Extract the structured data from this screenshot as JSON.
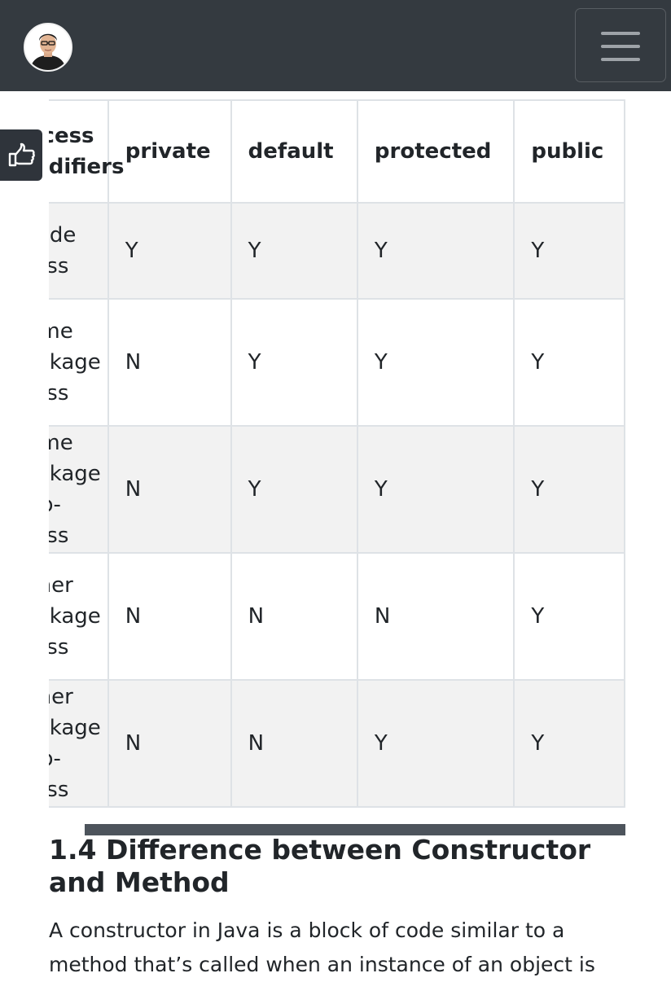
{
  "header": {
    "avatar_alt": "author avatar",
    "menu_icon": "hamburger-menu-icon",
    "background_color": "#343a40"
  },
  "side_tab": {
    "icon": "thumbs-up-hand-icon"
  },
  "access_table": {
    "headers": [
      "Access Modifiers",
      "private",
      "default",
      "protected",
      "public"
    ],
    "rows": [
      {
        "label": "Inside Class",
        "values": [
          "Y",
          "Y",
          "Y",
          "Y"
        ]
      },
      {
        "label": "Same Package Class",
        "values": [
          "N",
          "Y",
          "Y",
          "Y"
        ]
      },
      {
        "label": "Same Package Sub-Class",
        "values": [
          "N",
          "Y",
          "Y",
          "Y"
        ]
      },
      {
        "label": "Other Package Class",
        "values": [
          "N",
          "N",
          "N",
          "Y"
        ]
      },
      {
        "label": "Other Package Sub-Class",
        "values": [
          "N",
          "N",
          "Y",
          "Y"
        ]
      }
    ],
    "stripe_color": "#f2f2f2",
    "border_color": "#dee2e6"
  },
  "section": {
    "title": "1.4 Difference between Constructor and Method",
    "body": "A constructor in Java is a block of code similar to a method that’s called when an instance of an object is"
  }
}
